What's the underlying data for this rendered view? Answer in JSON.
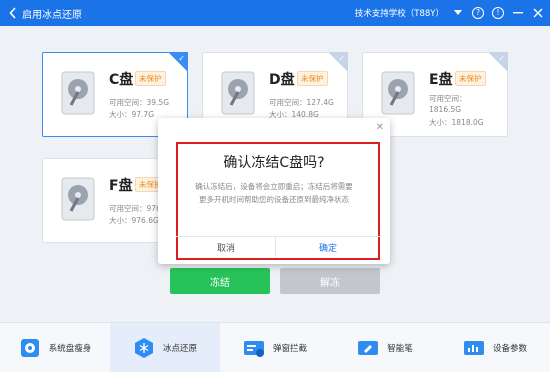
{
  "titlebar": {
    "back_icon": "chevron-left-icon",
    "title": "启用冰点还原",
    "school": "技术支持学校（T88Y）",
    "color": "#1a74e8"
  },
  "cards": [
    {
      "drive": "C盘",
      "tag": "未保护",
      "free_label": "可用空间：",
      "free": "39.5G",
      "size_label": "大小：",
      "size": "97.7G",
      "selected": true
    },
    {
      "drive": "D盘",
      "tag": "未保护",
      "free_label": "可用空间：",
      "free": "127.4G",
      "size_label": "大小：",
      "size": "140.8G",
      "selected": false
    },
    {
      "drive": "E盘",
      "tag": "未保护",
      "free_label": "可用空间：",
      "free": "1816.5G",
      "size_label": "大小：",
      "size": "1818.0G",
      "selected": false
    },
    {
      "drive": "F盘",
      "tag": "未保护",
      "free_label": "可用空间：",
      "free": "976",
      "size_label": "大小：",
      "size": "976.6G",
      "selected": false
    }
  ],
  "dialog": {
    "title": "确认冻结C盘吗?",
    "message_line1": "确认冻结后，设备将会立即重启；冻结后将需要",
    "message_line2": "更多开机时间帮助您的设备还原到最纯净状态",
    "cancel": "取消",
    "ok": "确定"
  },
  "actions": {
    "freeze": "冻结",
    "thaw": "解冻"
  },
  "bottom_nav": [
    {
      "label": "系统盘瘦身",
      "icon": "disk-slim-icon"
    },
    {
      "label": "冰点还原",
      "icon": "snowflake-icon",
      "active": true
    },
    {
      "label": "弹窗拦截",
      "icon": "popup-block-icon"
    },
    {
      "label": "智能笔",
      "icon": "smart-pen-icon"
    },
    {
      "label": "设备参数",
      "icon": "device-params-icon"
    }
  ]
}
